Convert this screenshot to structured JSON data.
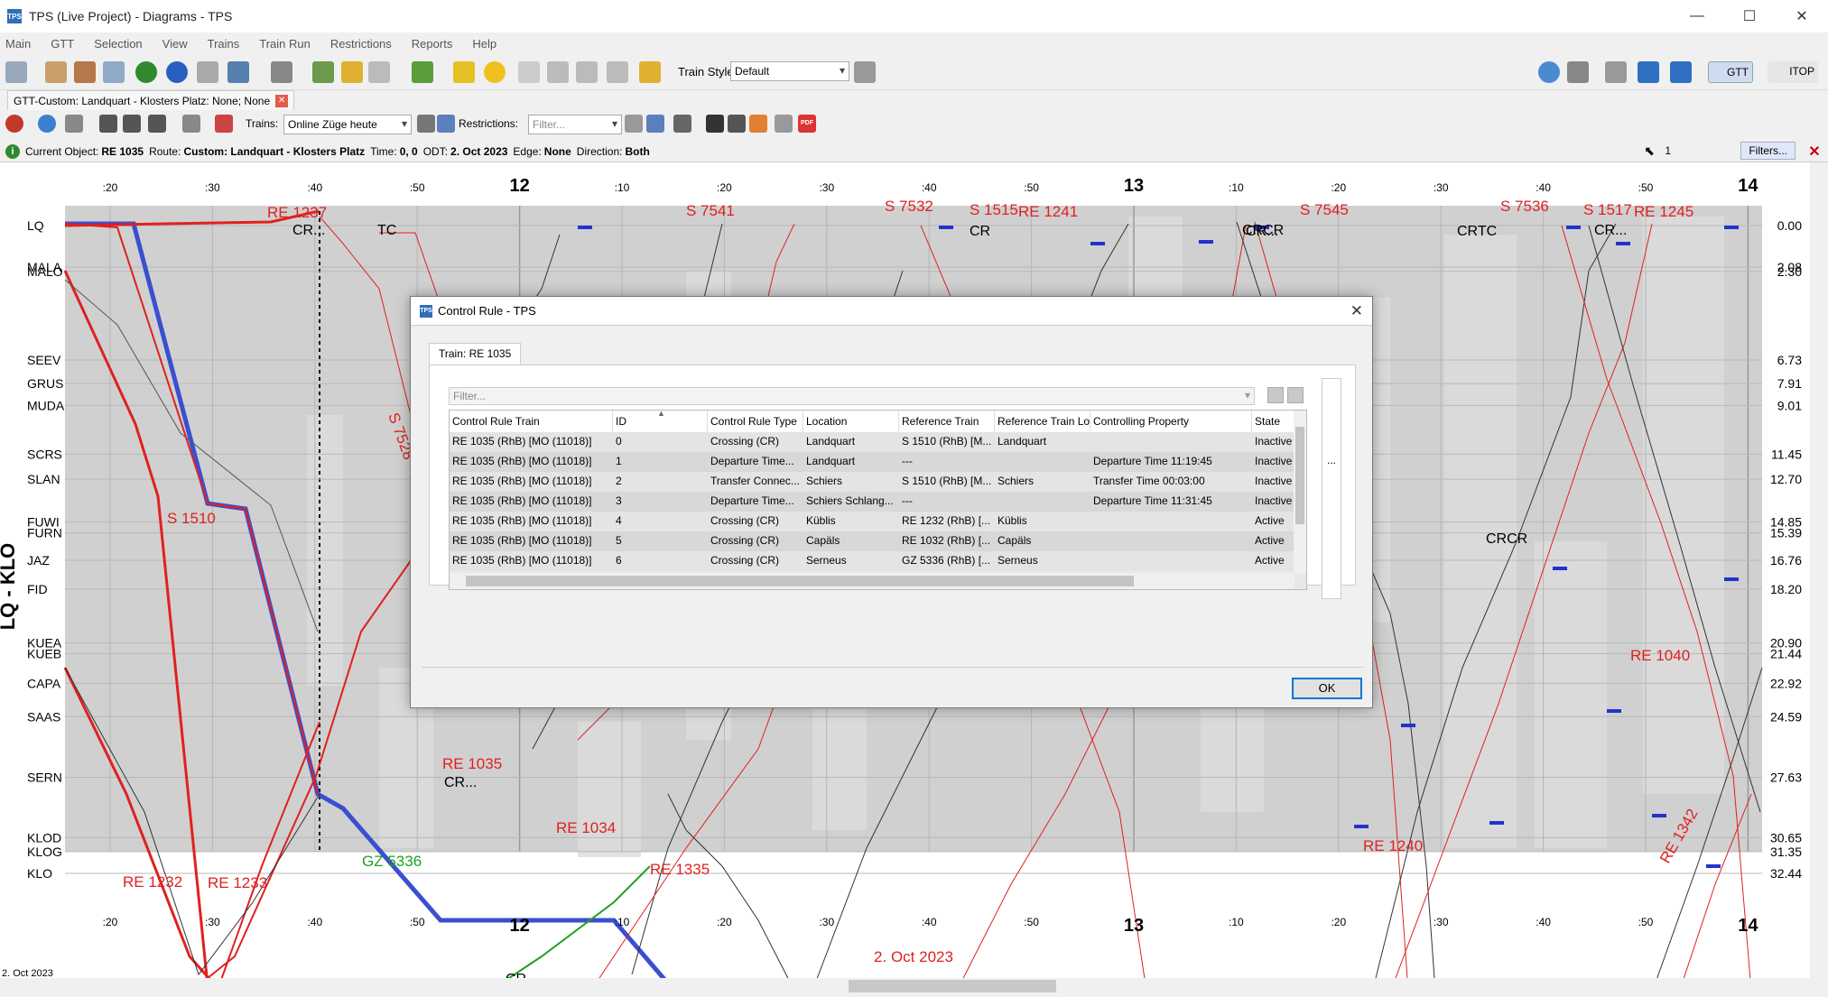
{
  "window": {
    "title": "TPS (Live Project) - Diagrams - TPS",
    "app_icon": "TPS",
    "min": "—",
    "max": "☐",
    "close": "✕"
  },
  "menu": [
    "Main",
    "GTT",
    "Selection",
    "View",
    "Trains",
    "Train Run",
    "Restrictions",
    "Reports",
    "Help"
  ],
  "toolbar": {
    "train_style_label": "Train Style",
    "train_style_value": "Default",
    "gtt_label": "GTT",
    "itop_label": "ITOP"
  },
  "doc_tab": {
    "label": "GTT-Custom: Landquart - Klosters Platz: None; None",
    "close": "✕"
  },
  "toolbar2": {
    "trains_label": "Trains:",
    "trains_value": "Online Züge heute",
    "restrictions_label": "Restrictions:",
    "restrictions_placeholder": "Filter...",
    "pdf_label": "PDF"
  },
  "status": {
    "current_object_label": "Current Object:",
    "current_object_value": "RE 1035",
    "route_label": "Route:",
    "route_value": "Custom: Landquart - Klosters Platz",
    "time_label": "Time:",
    "time_value": "0, 0",
    "odt_label": "ODT:",
    "odt_value": "2. Oct 2023",
    "edge_label": "Edge:",
    "edge_value": "None",
    "direction_label": "Direction:",
    "direction_value": "Both",
    "counter": "1",
    "filters_button": "Filters...",
    "close": "✕"
  },
  "diagram": {
    "route_axis_label": "LQ - KLO",
    "date_label": "2. Oct 2023",
    "footer_date": "2. Oct 2023",
    "time_ticks": [
      {
        "label": ":20",
        "hour": false
      },
      {
        "label": ":30",
        "hour": false
      },
      {
        "label": ":40",
        "hour": false
      },
      {
        "label": ":50",
        "hour": false
      },
      {
        "label": "12",
        "hour": true
      },
      {
        "label": ":10",
        "hour": false
      },
      {
        "label": ":20",
        "hour": false
      },
      {
        "label": ":30",
        "hour": false
      },
      {
        "label": ":40",
        "hour": false
      },
      {
        "label": ":50",
        "hour": false
      },
      {
        "label": "13",
        "hour": true
      },
      {
        "label": ":10",
        "hour": false
      },
      {
        "label": ":20",
        "hour": false
      },
      {
        "label": ":30",
        "hour": false
      },
      {
        "label": ":40",
        "hour": false
      },
      {
        "label": ":50",
        "hour": false
      },
      {
        "label": "14",
        "hour": true
      }
    ],
    "stations": [
      {
        "name": "LQ",
        "km": "0.00"
      },
      {
        "name": "MALA",
        "km": "2.08"
      },
      {
        "name": "MALO",
        "km": "2.30"
      },
      {
        "name": "SEEV",
        "km": "6.73"
      },
      {
        "name": "GRUS",
        "km": "7.91"
      },
      {
        "name": "MUDA",
        "km": "9.01"
      },
      {
        "name": "SCRS",
        "km": "11.45"
      },
      {
        "name": "SLAN",
        "km": "12.70"
      },
      {
        "name": "FUWI",
        "km": "14.85"
      },
      {
        "name": "FURN",
        "km": "15.39"
      },
      {
        "name": "JAZ",
        "km": "16.76"
      },
      {
        "name": "FID",
        "km": "18.20"
      },
      {
        "name": "KUEA",
        "km": "20.90"
      },
      {
        "name": "KUEB",
        "km": "21.44"
      },
      {
        "name": "CAPA",
        "km": "22.92"
      },
      {
        "name": "SAAS",
        "km": "24.59"
      },
      {
        "name": "SERN",
        "km": "27.63"
      },
      {
        "name": "KLOD",
        "km": "30.65"
      },
      {
        "name": "KLOG",
        "km": "31.35"
      },
      {
        "name": "KLO",
        "km": "32.44"
      }
    ],
    "train_labels": [
      {
        "text": "S 7541",
        "color": "#e02020"
      },
      {
        "text": "S 7532",
        "color": "#e02020"
      },
      {
        "text": "S 1515",
        "color": "#e02020"
      },
      {
        "text": "RE 1241",
        "color": "#e02020"
      },
      {
        "text": "S 7545",
        "color": "#e02020"
      },
      {
        "text": "S 7536",
        "color": "#e02020"
      },
      {
        "text": "S 1517",
        "color": "#e02020"
      },
      {
        "text": "RE 1245",
        "color": "#e02020"
      },
      {
        "text": "RE 1237",
        "color": "#e02020"
      },
      {
        "text": "S 1510",
        "color": "#e02020"
      },
      {
        "text": "S 7528",
        "color": "#e02020"
      },
      {
        "text": "RE 1035",
        "color": "#e02020"
      },
      {
        "text": "RE 1034",
        "color": "#e02020"
      },
      {
        "text": "RE 1335",
        "color": "#e02020"
      },
      {
        "text": "RE 1040",
        "color": "#e02020"
      },
      {
        "text": "RE 1232",
        "color": "#e02020"
      },
      {
        "text": "RE 1233",
        "color": "#e02020"
      },
      {
        "text": "RE 1240",
        "color": "#e02020"
      },
      {
        "text": "RE 1342",
        "color": "#e02020"
      },
      {
        "text": "GZ 5336",
        "color": "#22a022"
      }
    ],
    "cr_marks": [
      "CR...",
      "TC",
      "CR",
      "CRTC",
      "CR...",
      "CRCR",
      "CR...",
      "CR",
      "CRCR",
      "CR...",
      "TCR"
    ],
    "colors": {
      "selected_train": "#3a4fd0",
      "train": "#e02020",
      "background": "#d0d0d0",
      "occupancy": "#dcdcdc",
      "freight": "#22a022"
    }
  },
  "dialog": {
    "title": "Control Rule - TPS",
    "tab": "Train: RE 1035",
    "filter_placeholder": "Filter...",
    "columns": [
      "Control Rule Train",
      "ID",
      "Control Rule Type",
      "Location",
      "Reference Train",
      "Reference Train Lo",
      "Controlling Property",
      "State"
    ],
    "rows": [
      [
        "RE 1035 (RhB) [MO (11018)]",
        "0",
        "Crossing (CR)",
        "Landquart",
        "S 1510 (RhB) [M...",
        "Landquart",
        "",
        "Inactive"
      ],
      [
        "RE 1035 (RhB) [MO (11018)]",
        "1",
        "Departure Time...",
        "Landquart",
        "---",
        "",
        "Departure Time 11:19:45",
        "Inactive"
      ],
      [
        "RE 1035 (RhB) [MO (11018)]",
        "2",
        "Transfer Connec...",
        "Schiers",
        "S 1510 (RhB) [M...",
        "Schiers",
        "Transfer Time 00:03:00",
        "Inactive"
      ],
      [
        "RE 1035 (RhB) [MO (11018)]",
        "3",
        "Departure Time...",
        "Schiers Schlang...",
        "---",
        "",
        "Departure Time 11:31:45",
        "Inactive"
      ],
      [
        "RE 1035 (RhB) [MO (11018)]",
        "4",
        "Crossing (CR)",
        "Küblis",
        "RE 1232 (RhB) [...",
        "Küblis",
        "",
        "Active"
      ],
      [
        "RE 1035 (RhB) [MO (11018)]",
        "5",
        "Crossing (CR)",
        "Capäls",
        "RE 1032 (RhB) [...",
        "Capäls",
        "",
        "Active"
      ],
      [
        "RE 1035 (RhB) [MO (11018)]",
        "6",
        "Crossing (CR)",
        "Serneus",
        "GZ 5336 (RhB) [...",
        "Serneus",
        "",
        "Active"
      ]
    ],
    "side_more": "...",
    "ok": "OK",
    "close": "✕"
  }
}
